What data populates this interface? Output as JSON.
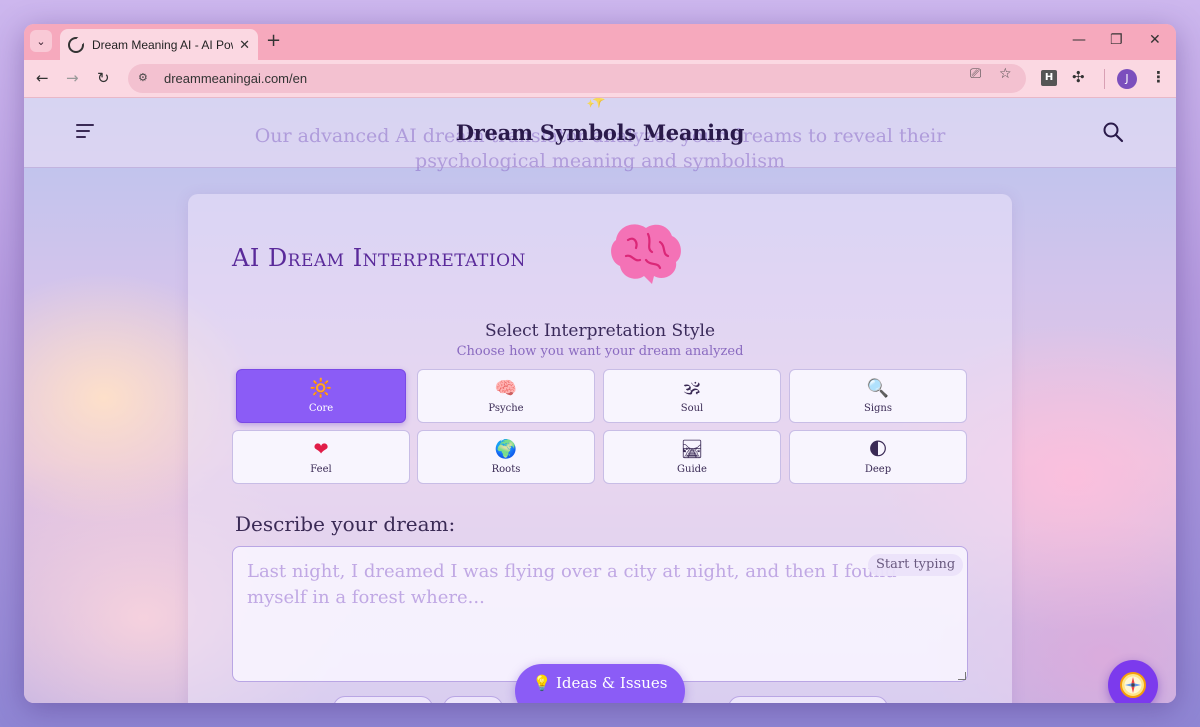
{
  "browser": {
    "tab_title": "Dream Meaning AI - AI Powere",
    "tab_close": "✕",
    "new_tab": "+",
    "url": "dreammeaningai.com/en",
    "avatar_letter": "J",
    "extension_letter": "H",
    "minimize": "—",
    "restore": "❐",
    "close": "✕"
  },
  "header": {
    "brand": "Dream Symbols Meaning",
    "hero_subtitle": "Our advanced AI dream translator analyzes your dreams to reveal their psychological meaning and symbolism"
  },
  "card": {
    "title": "AI Dream Interpretation",
    "style_title": "Select Interpretation Style",
    "style_subtitle": "Choose how you want your dream analyzed",
    "options": [
      {
        "label": "Core",
        "icon": "sun-emoji",
        "glyph": "🔆",
        "active": true
      },
      {
        "label": "Psyche",
        "icon": "brain-emoji",
        "glyph": "🧠",
        "active": false
      },
      {
        "label": "Soul",
        "icon": "om-emoji",
        "glyph": "🕉",
        "active": false
      },
      {
        "label": "Signs",
        "icon": "magnifier-emoji",
        "glyph": "🔍",
        "active": false
      },
      {
        "label": "Feel",
        "icon": "heart-emoji",
        "glyph": "❤",
        "active": false
      },
      {
        "label": "Roots",
        "icon": "globe-emoji",
        "glyph": "🌍",
        "active": false
      },
      {
        "label": "Guide",
        "icon": "road-emoji",
        "glyph": "🛤",
        "active": false
      },
      {
        "label": "Deep",
        "icon": "half-moon-emoji",
        "glyph": "🌓",
        "active": false
      }
    ],
    "describe_label": "Describe your dream:",
    "dream_placeholder": "Last night, I dreamed I was flying over a city at night, and then I found myself in a forest where...",
    "typing_hint": "Start typing"
  },
  "footer": {
    "ideas_button": "💡 Ideas & Issues"
  },
  "colors": {
    "accent": "#8b5cf6",
    "title": "#5a2a9a",
    "tabstrip": "#f6a9bd"
  }
}
